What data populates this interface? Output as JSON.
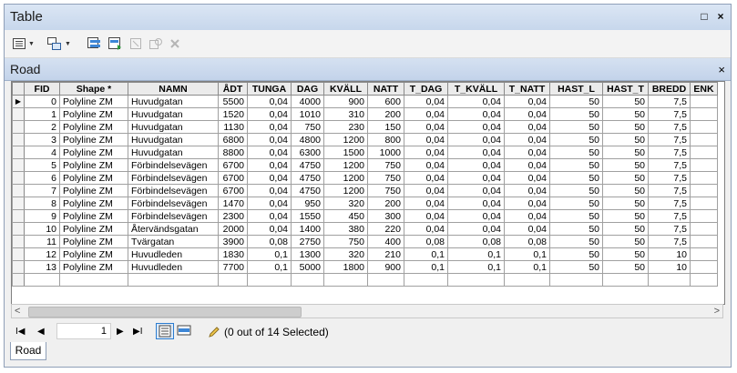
{
  "window": {
    "title": "Table",
    "restore_glyph": "□",
    "close_glyph": "×"
  },
  "toolbar": {
    "items": [
      "table-options-icon",
      "related-tables-icon",
      "select-by-attributes-icon",
      "switch-selection-icon",
      "clear-selection-icon",
      "zoom-to-selected-icon",
      "delete-selected-icon"
    ]
  },
  "tab": {
    "name": "Road",
    "close_glyph": "×"
  },
  "columns": [
    "FID",
    "Shape *",
    "NAMN",
    "ÅDT",
    "TUNGA",
    "DAG",
    "KVÄLL",
    "NATT",
    "T_DAG",
    "T_KVÄLL",
    "T_NATT",
    "HAST_L",
    "HAST_T",
    "BREDD",
    "ENK"
  ],
  "rows": [
    [
      "0",
      "Polyline ZM",
      "Huvudgatan",
      "5500",
      "0,04",
      "4000",
      "900",
      "600",
      "0,04",
      "0,04",
      "0,04",
      "50",
      "50",
      "7,5",
      ""
    ],
    [
      "1",
      "Polyline ZM",
      "Huvudgatan",
      "1520",
      "0,04",
      "1010",
      "310",
      "200",
      "0,04",
      "0,04",
      "0,04",
      "50",
      "50",
      "7,5",
      ""
    ],
    [
      "2",
      "Polyline ZM",
      "Huvudgatan",
      "1130",
      "0,04",
      "750",
      "230",
      "150",
      "0,04",
      "0,04",
      "0,04",
      "50",
      "50",
      "7,5",
      ""
    ],
    [
      "3",
      "Polyline ZM",
      "Huvudgatan",
      "6800",
      "0,04",
      "4800",
      "1200",
      "800",
      "0,04",
      "0,04",
      "0,04",
      "50",
      "50",
      "7,5",
      ""
    ],
    [
      "4",
      "Polyline ZM",
      "Huvudgatan",
      "8800",
      "0,04",
      "6300",
      "1500",
      "1000",
      "0,04",
      "0,04",
      "0,04",
      "50",
      "50",
      "7,5",
      ""
    ],
    [
      "5",
      "Polyline ZM",
      "Förbindelsevägen",
      "6700",
      "0,04",
      "4750",
      "1200",
      "750",
      "0,04",
      "0,04",
      "0,04",
      "50",
      "50",
      "7,5",
      ""
    ],
    [
      "6",
      "Polyline ZM",
      "Förbindelsevägen",
      "6700",
      "0,04",
      "4750",
      "1200",
      "750",
      "0,04",
      "0,04",
      "0,04",
      "50",
      "50",
      "7,5",
      ""
    ],
    [
      "7",
      "Polyline ZM",
      "Förbindelsevägen",
      "6700",
      "0,04",
      "4750",
      "1200",
      "750",
      "0,04",
      "0,04",
      "0,04",
      "50",
      "50",
      "7,5",
      ""
    ],
    [
      "8",
      "Polyline ZM",
      "Förbindelsevägen",
      "1470",
      "0,04",
      "950",
      "320",
      "200",
      "0,04",
      "0,04",
      "0,04",
      "50",
      "50",
      "7,5",
      ""
    ],
    [
      "9",
      "Polyline ZM",
      "Förbindelsevägen",
      "2300",
      "0,04",
      "1550",
      "450",
      "300",
      "0,04",
      "0,04",
      "0,04",
      "50",
      "50",
      "7,5",
      ""
    ],
    [
      "10",
      "Polyline ZM",
      "Återvändsgatan",
      "2000",
      "0,04",
      "1400",
      "380",
      "220",
      "0,04",
      "0,04",
      "0,04",
      "50",
      "50",
      "7,5",
      ""
    ],
    [
      "11",
      "Polyline ZM",
      "Tvärgatan",
      "3900",
      "0,08",
      "2750",
      "750",
      "400",
      "0,08",
      "0,08",
      "0,08",
      "50",
      "50",
      "7,5",
      ""
    ],
    [
      "12",
      "Polyline ZM",
      "Huvudleden",
      "1830",
      "0,1",
      "1300",
      "320",
      "210",
      "0,1",
      "0,1",
      "0,1",
      "50",
      "50",
      "10",
      ""
    ],
    [
      "13",
      "Polyline ZM",
      "Huvudleden",
      "7700",
      "0,1",
      "5000",
      "1800",
      "900",
      "0,1",
      "0,1",
      "0,1",
      "50",
      "50",
      "10",
      ""
    ]
  ],
  "current_row_marker": "▶",
  "navigation": {
    "first": "I◀",
    "prev": "◀",
    "page": "1",
    "next": "▶",
    "last": "▶I"
  },
  "selection_status": "(0 out of 14 Selected)",
  "bottom_tab": "Road"
}
